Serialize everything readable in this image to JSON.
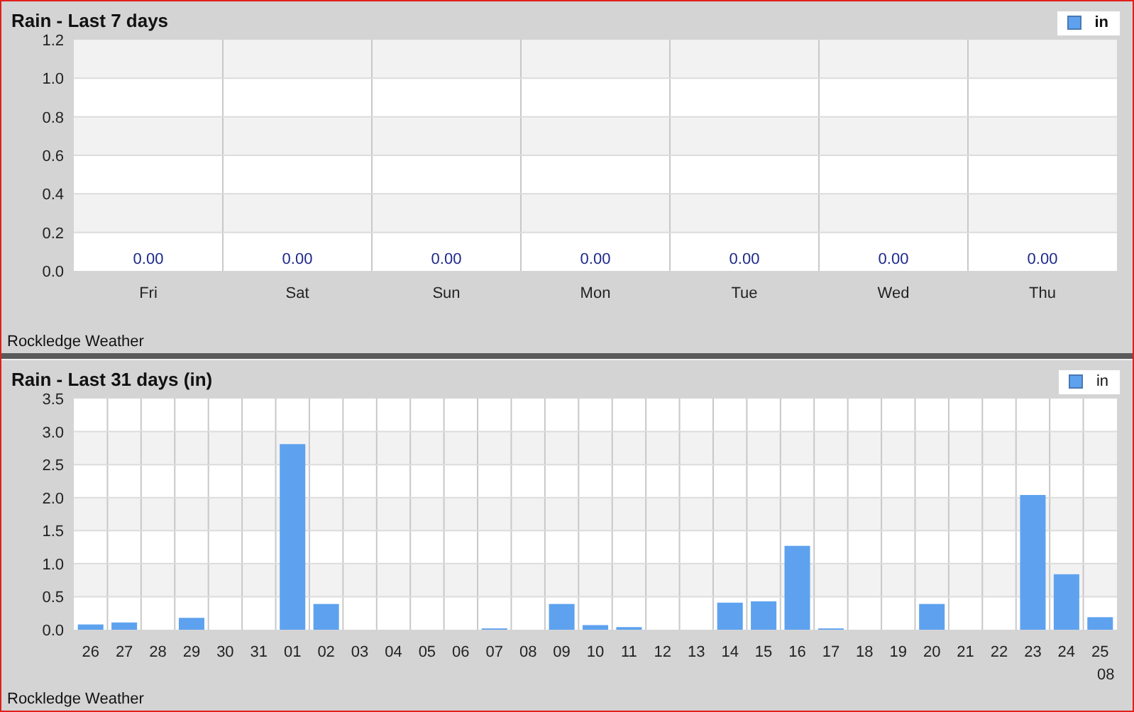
{
  "panels": [
    {
      "footer": "Rockledge Weather",
      "chart_data": {
        "type": "bar",
        "title": "Rain - Last 7 days",
        "grid": true,
        "categories": [
          "Fri",
          "Sat",
          "Sun",
          "Mon",
          "Tue",
          "Wed",
          "Thu"
        ],
        "series": [
          {
            "name": "in",
            "color": "#5ea2ef",
            "values": [
              0,
              0,
              0,
              0,
              0,
              0,
              0
            ]
          }
        ],
        "ylim": [
          0,
          1.2
        ],
        "yticks": [
          {
            "value": 0,
            "label": "0.0"
          },
          {
            "value": 0.2,
            "label": "0.2"
          },
          {
            "value": 0.4,
            "label": "0.4"
          },
          {
            "value": 0.6,
            "label": "0.6"
          },
          {
            "value": 0.8,
            "label": "0.8"
          },
          {
            "value": 1,
            "label": "1.0"
          },
          {
            "value": 1.2,
            "label": "1.2"
          }
        ],
        "value_labels": [
          "0.00",
          "0.00",
          "0.00",
          "0.00",
          "0.00",
          "0.00",
          "0.00"
        ]
      }
    },
    {
      "footer": "Rockledge Weather",
      "month_label": "08",
      "chart_data": {
        "type": "bar",
        "title": "Rain - Last 31 days (in)",
        "grid": true,
        "categories": [
          "26",
          "27",
          "28",
          "29",
          "30",
          "31",
          "01",
          "02",
          "03",
          "04",
          "05",
          "06",
          "07",
          "08",
          "09",
          "10",
          "11",
          "12",
          "13",
          "14",
          "15",
          "16",
          "17",
          "18",
          "19",
          "20",
          "21",
          "22",
          "23",
          "24",
          "25"
        ],
        "series": [
          {
            "name": "in",
            "color": "#5ea2ef",
            "values": [
              0.08,
              0.11,
              0,
              0.18,
              0,
              0,
              2.81,
              0.39,
              0,
              0,
              0,
              0,
              0.02,
              0,
              0.39,
              0.07,
              0.04,
              0,
              0,
              0.41,
              0.43,
              1.27,
              0.02,
              0,
              0,
              0.39,
              0,
              0,
              2.04,
              0.84,
              0.19
            ]
          }
        ],
        "ylim": [
          0,
          3.5
        ],
        "yticks": [
          {
            "value": 0,
            "label": "0.0"
          },
          {
            "value": 0.5,
            "label": "0.5"
          },
          {
            "value": 1,
            "label": "1.0"
          },
          {
            "value": 1.5,
            "label": "1.5"
          },
          {
            "value": 2,
            "label": "2.0"
          },
          {
            "value": 2.5,
            "label": "2.5"
          },
          {
            "value": 3,
            "label": "3.0"
          },
          {
            "value": 3.5,
            "label": "3.5"
          }
        ]
      }
    }
  ]
}
